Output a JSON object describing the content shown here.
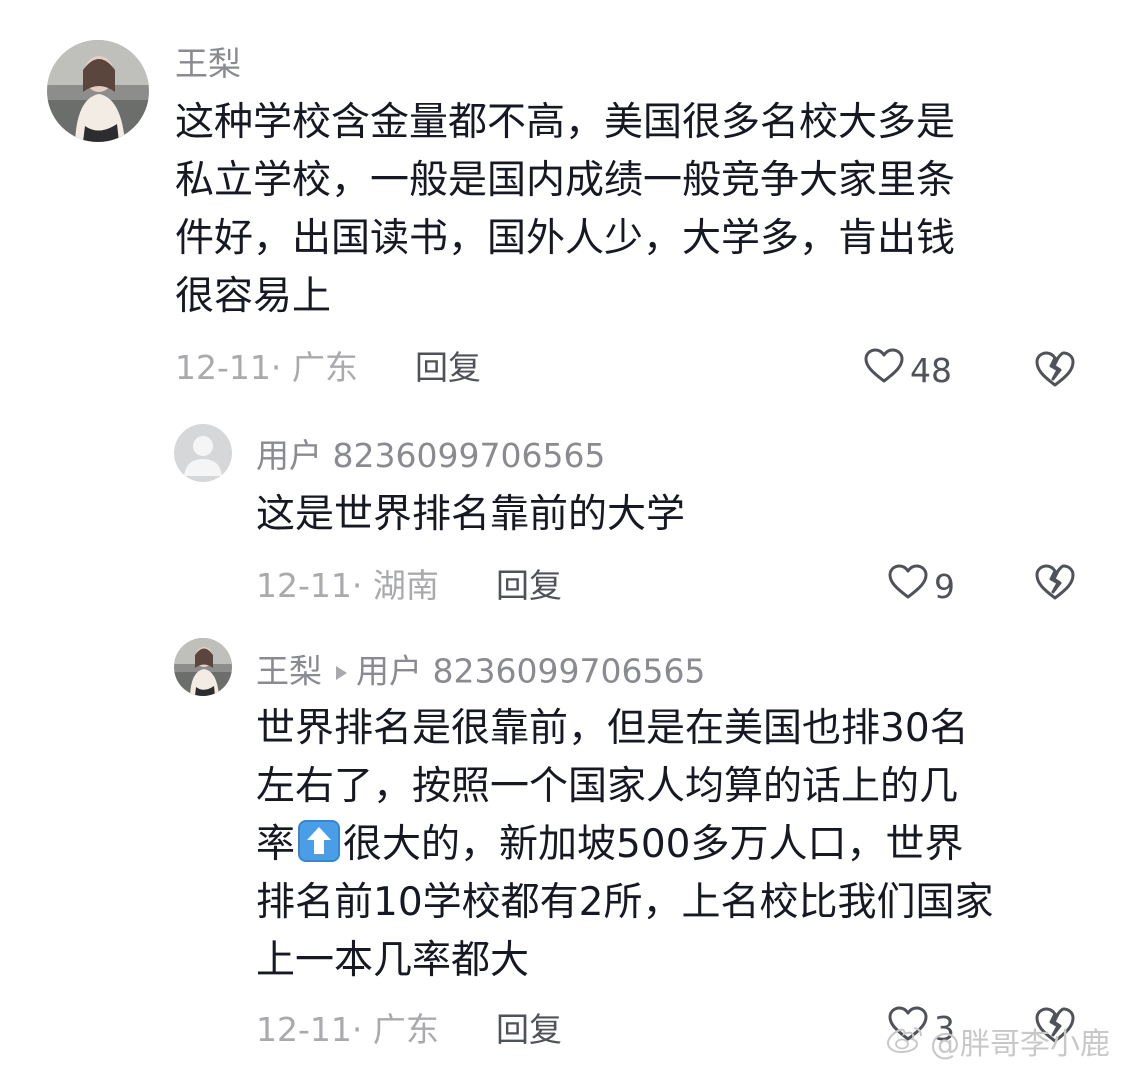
{
  "comments": [
    {
      "username": "王梨",
      "content_lines": [
        "这种学校含金量都不高，美国很多名校大多是",
        "私立学校，一般是国内成绩一般竞争大家里条",
        "件好，出国读书，国外人少，大学多，肯出钱",
        "很容易上"
      ],
      "date_location": "12-11· 广东",
      "reply_label": "回复",
      "like_count": "48"
    },
    {
      "username": "用户 8236099706565",
      "content_lines": [
        "这是世界排名靠前的大学"
      ],
      "date_location": "12-11· 湖南",
      "reply_label": "回复",
      "like_count": "9"
    },
    {
      "username": "王梨",
      "reply_to": "用户 8236099706565",
      "content_line1": "世界排名是很靠前，但是在美国也排30名",
      "content_line2": "左右了，按照一个国家人均算的话上的几",
      "content_line3_before": "率",
      "content_line3_emoji": "up-arrow-emoji",
      "content_line3_after": "很大的，新加坡500多万人口，世界",
      "content_line4": "排名前10学校都有2所，上名校比我们国家",
      "content_line5": "上一本几率都大",
      "date_location": "12-11· 广东",
      "reply_label": "回复",
      "like_count": "3"
    }
  ],
  "watermark": {
    "text": "@胖哥李小鹿",
    "icon": "weibo-icon"
  },
  "colors": {
    "text_primary": "#161823",
    "text_secondary": "#8a8b91",
    "text_meta": "#a9aaad",
    "action": "#505259",
    "emoji_blue": "#4a9ee8"
  }
}
